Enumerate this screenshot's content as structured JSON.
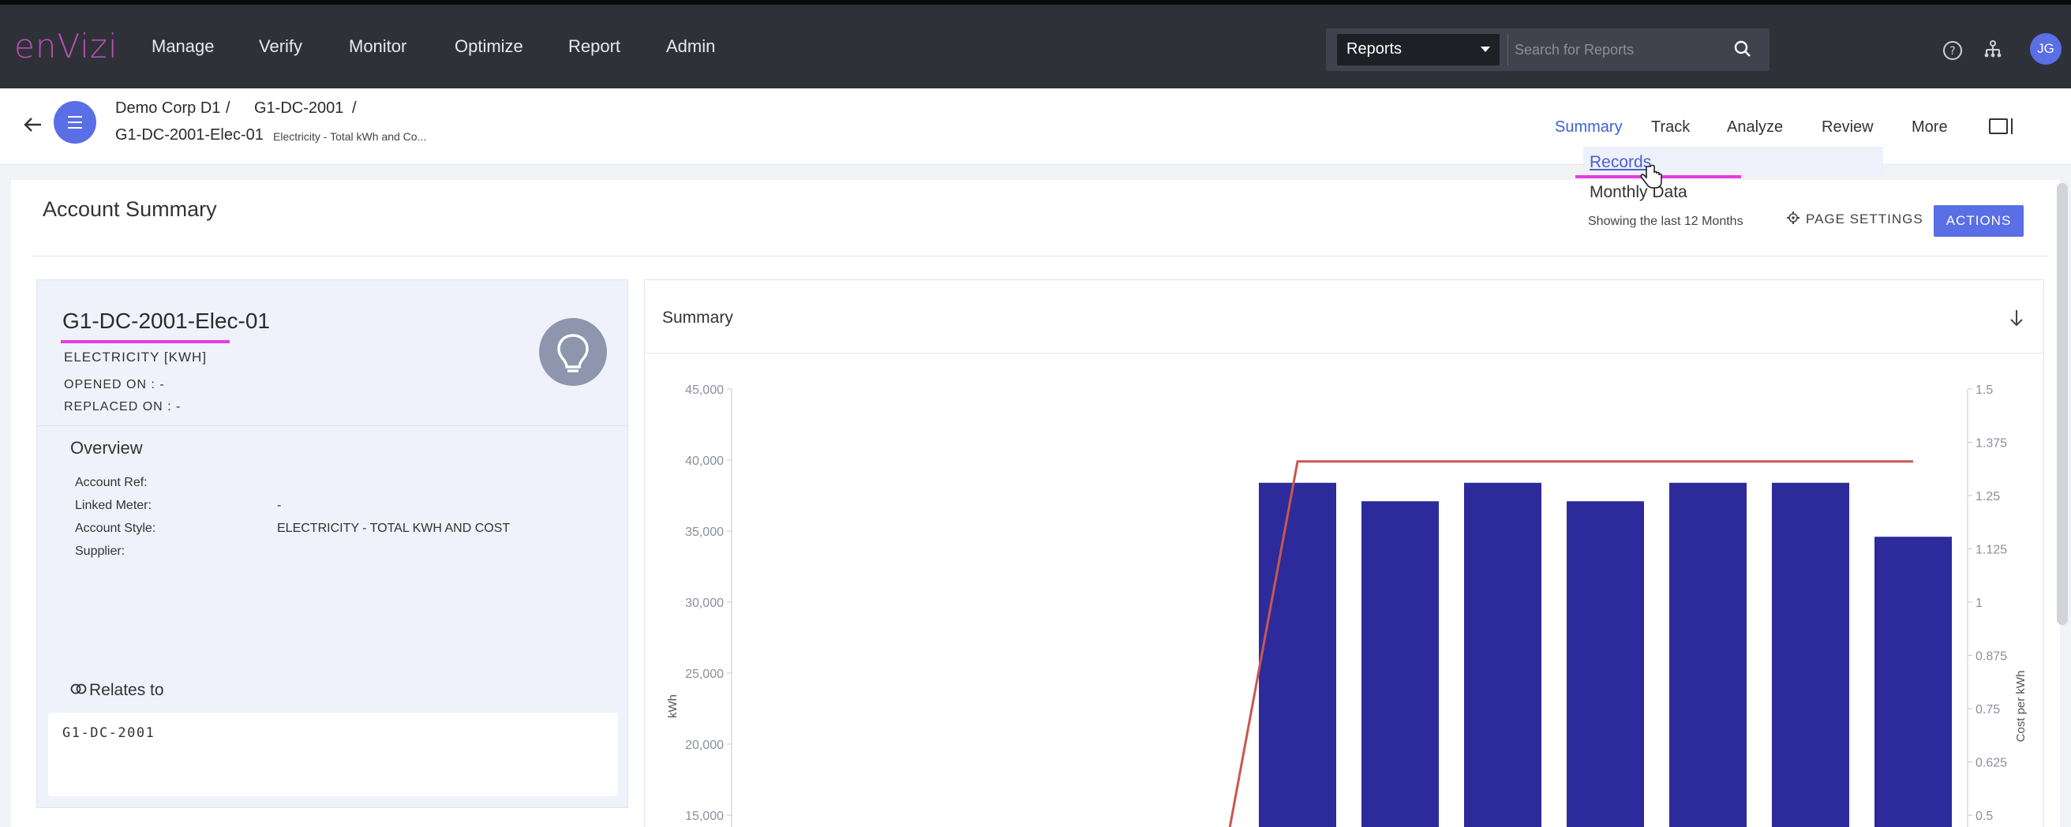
{
  "topnav": {
    "logo": "enVizi",
    "items": [
      "Manage",
      "Verify",
      "Monitor",
      "Optimize",
      "Report",
      "Admin"
    ],
    "search": {
      "selected": "Reports",
      "placeholder": "Search for Reports"
    },
    "icons": [
      "help-icon",
      "hierarchy-icon"
    ],
    "avatar": "JG"
  },
  "subheader": {
    "breadcrumb": [
      "Demo Corp D1",
      "G1-DC-2001"
    ],
    "separator": "/",
    "account": "G1-DC-2001-Elec-01",
    "account_desc": "Electricity - Total kWh and Co...",
    "tabs": [
      "Summary",
      "Track",
      "Analyze",
      "Review",
      "More"
    ],
    "active_tab": "Summary"
  },
  "dropdown": {
    "items": [
      "Records",
      "Monthly Data"
    ]
  },
  "card": {
    "title": "Account Summary",
    "showing": "Showing the last 12 Months",
    "page_settings": "PAGE SETTINGS",
    "actions": "ACTIONS"
  },
  "info": {
    "name": "G1-DC-2001-Elec-01",
    "type": "ELECTRICITY [KWH]",
    "opened": "OPENED ON : -",
    "replaced": "REPLACED ON : -",
    "overview_title": "Overview",
    "fields": [
      {
        "label": "Account Ref:",
        "value": ""
      },
      {
        "label": "Linked Meter:",
        "value": "-"
      },
      {
        "label": "Account Style:",
        "value": "ELECTRICITY - TOTAL KWH AND COST"
      },
      {
        "label": "Supplier:",
        "value": ""
      }
    ],
    "relates_title": "Relates to",
    "relates_items": [
      "G1-DC-2001"
    ]
  },
  "chart_data": {
    "type": "bar",
    "title": "Summary",
    "ylabel": "kWh",
    "y2label": "Cost per kWh",
    "ylim": [
      15000,
      45000
    ],
    "y2lim": [
      0.5,
      1.5
    ],
    "yticks": [
      "45,000",
      "40,000",
      "35,000",
      "30,000",
      "25,000",
      "20,000",
      "15,000"
    ],
    "y2ticks": [
      "1.5",
      "1.375",
      "1.25",
      "1.125",
      "1",
      "0.875",
      "0.75",
      "0.625",
      "0.5"
    ],
    "categories_count": 12,
    "bars": [
      null,
      null,
      null,
      null,
      null,
      38400,
      37100,
      38400,
      37100,
      38400,
      38400,
      34600
    ],
    "line": [
      null,
      null,
      null,
      0.3,
      null,
      1.33,
      1.33,
      1.33,
      1.33,
      1.33,
      1.33,
      1.33
    ],
    "bar_color": "#2d2a9b",
    "line_color": "#c9574f"
  },
  "colors": {
    "accent": "#5a6ee6",
    "highlight": "#e63be0",
    "nav_bg": "#2f3139"
  }
}
